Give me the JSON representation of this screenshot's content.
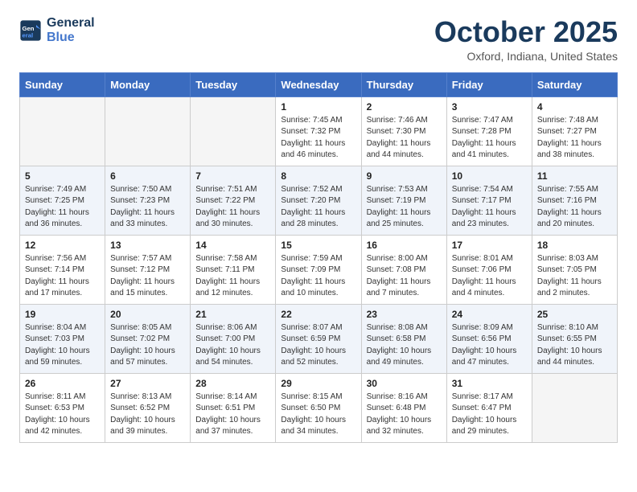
{
  "header": {
    "logo_line1": "General",
    "logo_line2": "Blue",
    "month_title": "October 2025",
    "location": "Oxford, Indiana, United States"
  },
  "days_of_week": [
    "Sunday",
    "Monday",
    "Tuesday",
    "Wednesday",
    "Thursday",
    "Friday",
    "Saturday"
  ],
  "weeks": [
    {
      "shaded": false,
      "days": [
        {
          "number": "",
          "info": ""
        },
        {
          "number": "",
          "info": ""
        },
        {
          "number": "",
          "info": ""
        },
        {
          "number": "1",
          "info": "Sunrise: 7:45 AM\nSunset: 7:32 PM\nDaylight: 11 hours\nand 46 minutes."
        },
        {
          "number": "2",
          "info": "Sunrise: 7:46 AM\nSunset: 7:30 PM\nDaylight: 11 hours\nand 44 minutes."
        },
        {
          "number": "3",
          "info": "Sunrise: 7:47 AM\nSunset: 7:28 PM\nDaylight: 11 hours\nand 41 minutes."
        },
        {
          "number": "4",
          "info": "Sunrise: 7:48 AM\nSunset: 7:27 PM\nDaylight: 11 hours\nand 38 minutes."
        }
      ]
    },
    {
      "shaded": true,
      "days": [
        {
          "number": "5",
          "info": "Sunrise: 7:49 AM\nSunset: 7:25 PM\nDaylight: 11 hours\nand 36 minutes."
        },
        {
          "number": "6",
          "info": "Sunrise: 7:50 AM\nSunset: 7:23 PM\nDaylight: 11 hours\nand 33 minutes."
        },
        {
          "number": "7",
          "info": "Sunrise: 7:51 AM\nSunset: 7:22 PM\nDaylight: 11 hours\nand 30 minutes."
        },
        {
          "number": "8",
          "info": "Sunrise: 7:52 AM\nSunset: 7:20 PM\nDaylight: 11 hours\nand 28 minutes."
        },
        {
          "number": "9",
          "info": "Sunrise: 7:53 AM\nSunset: 7:19 PM\nDaylight: 11 hours\nand 25 minutes."
        },
        {
          "number": "10",
          "info": "Sunrise: 7:54 AM\nSunset: 7:17 PM\nDaylight: 11 hours\nand 23 minutes."
        },
        {
          "number": "11",
          "info": "Sunrise: 7:55 AM\nSunset: 7:16 PM\nDaylight: 11 hours\nand 20 minutes."
        }
      ]
    },
    {
      "shaded": false,
      "days": [
        {
          "number": "12",
          "info": "Sunrise: 7:56 AM\nSunset: 7:14 PM\nDaylight: 11 hours\nand 17 minutes."
        },
        {
          "number": "13",
          "info": "Sunrise: 7:57 AM\nSunset: 7:12 PM\nDaylight: 11 hours\nand 15 minutes."
        },
        {
          "number": "14",
          "info": "Sunrise: 7:58 AM\nSunset: 7:11 PM\nDaylight: 11 hours\nand 12 minutes."
        },
        {
          "number": "15",
          "info": "Sunrise: 7:59 AM\nSunset: 7:09 PM\nDaylight: 11 hours\nand 10 minutes."
        },
        {
          "number": "16",
          "info": "Sunrise: 8:00 AM\nSunset: 7:08 PM\nDaylight: 11 hours\nand 7 minutes."
        },
        {
          "number": "17",
          "info": "Sunrise: 8:01 AM\nSunset: 7:06 PM\nDaylight: 11 hours\nand 4 minutes."
        },
        {
          "number": "18",
          "info": "Sunrise: 8:03 AM\nSunset: 7:05 PM\nDaylight: 11 hours\nand 2 minutes."
        }
      ]
    },
    {
      "shaded": true,
      "days": [
        {
          "number": "19",
          "info": "Sunrise: 8:04 AM\nSunset: 7:03 PM\nDaylight: 10 hours\nand 59 minutes."
        },
        {
          "number": "20",
          "info": "Sunrise: 8:05 AM\nSunset: 7:02 PM\nDaylight: 10 hours\nand 57 minutes."
        },
        {
          "number": "21",
          "info": "Sunrise: 8:06 AM\nSunset: 7:00 PM\nDaylight: 10 hours\nand 54 minutes."
        },
        {
          "number": "22",
          "info": "Sunrise: 8:07 AM\nSunset: 6:59 PM\nDaylight: 10 hours\nand 52 minutes."
        },
        {
          "number": "23",
          "info": "Sunrise: 8:08 AM\nSunset: 6:58 PM\nDaylight: 10 hours\nand 49 minutes."
        },
        {
          "number": "24",
          "info": "Sunrise: 8:09 AM\nSunset: 6:56 PM\nDaylight: 10 hours\nand 47 minutes."
        },
        {
          "number": "25",
          "info": "Sunrise: 8:10 AM\nSunset: 6:55 PM\nDaylight: 10 hours\nand 44 minutes."
        }
      ]
    },
    {
      "shaded": false,
      "days": [
        {
          "number": "26",
          "info": "Sunrise: 8:11 AM\nSunset: 6:53 PM\nDaylight: 10 hours\nand 42 minutes."
        },
        {
          "number": "27",
          "info": "Sunrise: 8:13 AM\nSunset: 6:52 PM\nDaylight: 10 hours\nand 39 minutes."
        },
        {
          "number": "28",
          "info": "Sunrise: 8:14 AM\nSunset: 6:51 PM\nDaylight: 10 hours\nand 37 minutes."
        },
        {
          "number": "29",
          "info": "Sunrise: 8:15 AM\nSunset: 6:50 PM\nDaylight: 10 hours\nand 34 minutes."
        },
        {
          "number": "30",
          "info": "Sunrise: 8:16 AM\nSunset: 6:48 PM\nDaylight: 10 hours\nand 32 minutes."
        },
        {
          "number": "31",
          "info": "Sunrise: 8:17 AM\nSunset: 6:47 PM\nDaylight: 10 hours\nand 29 minutes."
        },
        {
          "number": "",
          "info": ""
        }
      ]
    }
  ]
}
